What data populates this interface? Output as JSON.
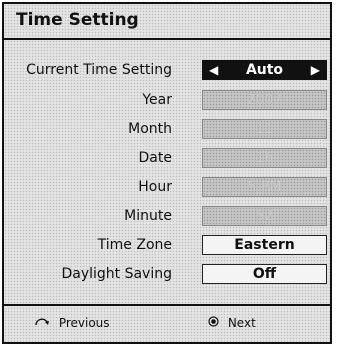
{
  "title": "Time Setting",
  "rows": [
    {
      "label": "Current Time Setting",
      "value": "Auto"
    },
    {
      "label": "Year",
      "value": "2007"
    },
    {
      "label": "Month",
      "value": "11"
    },
    {
      "label": "Date",
      "value": "16"
    },
    {
      "label": "Hour",
      "value": "5 PM"
    },
    {
      "label": "Minute",
      "value": "52"
    },
    {
      "label": "Time Zone",
      "value": "Eastern"
    },
    {
      "label": "Daylight Saving",
      "value": "Off"
    }
  ],
  "arrows": {
    "left": "◀",
    "right": "▶"
  },
  "footer": {
    "previous_label": "Previous",
    "previous_icon": "return-arrow-icon",
    "next_label": "Next",
    "next_icon": "enter-button-icon"
  }
}
